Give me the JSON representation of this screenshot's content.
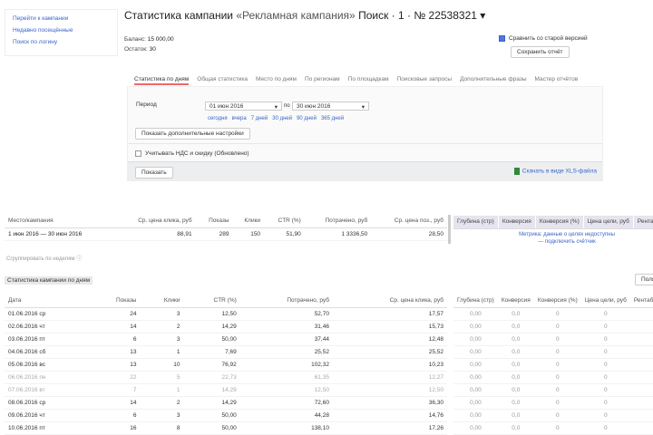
{
  "sidebar": {
    "links": [
      "Перейти к кампании",
      "Недавно посещённые",
      "Поиск по логину"
    ]
  },
  "header": {
    "title": "Статистика кампании",
    "campaign": "«Рекламная кампания»",
    "suffix": "Поиск · 1 · № 22538321 ▾",
    "balance_label": "Баланс:",
    "balance": "15 000,00",
    "rest_label": "Остаток:",
    "rest": "30",
    "compare_label": "Сравнить со старой версией",
    "save_button": "Сохранить отчёт"
  },
  "tabs": [
    "Статистика по дням",
    "Общая статистика",
    "Место по дням",
    "По регионам",
    "По площадкам",
    "Поисковые запросы",
    "Дополнительные фразы",
    "Мастер отчётов"
  ],
  "filter": {
    "period_label": "Период",
    "date_from": "01 июн 2016",
    "to_label": "по",
    "date_to": "30 июн 2016",
    "quick": [
      "сегодня",
      "вчера",
      "7 дней",
      "30 дней",
      "90 дней",
      "365 дней"
    ],
    "more_settings": "Показать дополнительные настройки",
    "checkbox_label": "Учитывать НДС и скидку (Обновлено)",
    "show_button": "Показать",
    "excel_link": "Скачать в виде XLS-файла"
  },
  "summary": {
    "headers": [
      "Место/кампания",
      "Ср. цена клика, руб",
      "Показы",
      "Клики",
      "CTR (%)",
      "Потрачено, руб",
      "Ср. цена поз., руб"
    ],
    "row": [
      "1 июн 2016 — 30 июн 2016",
      "88,91",
      "289",
      "150",
      "51,90",
      "1 3336,50",
      "28,50"
    ],
    "right_headers": [
      "Глубина (стр)",
      "Конверсия",
      "Конверсия (%)",
      "Цена цели, руб",
      "Рентабельность"
    ],
    "right_link": "Метрика: данные о целях недоступны — подключить счётчик",
    "group_note": "Сгруппировать по неделям  ⓘ"
  },
  "daily": {
    "section_title": "Статистика кампании по дням",
    "settings_button": "Поля",
    "headers": [
      "Дата",
      "Показы",
      "Клики",
      "CTR (%)",
      "Потрачено, руб",
      "Ср. цена клика, руб"
    ],
    "right_headers": [
      "Глубина (стр)",
      "Конверсия",
      "Конверсия (%)",
      "Цена цели, руб",
      "Рентабельность"
    ],
    "rows": [
      [
        "01.06.2016 ср",
        "24",
        "3",
        "12,50",
        "52,70",
        "17,57"
      ],
      [
        "02.06.2016 чт",
        "14",
        "2",
        "14,29",
        "31,46",
        "15,73"
      ],
      [
        "03.06.2016 пт",
        "6",
        "3",
        "50,00",
        "37,44",
        "12,48"
      ],
      [
        "04.06.2016 сб",
        "13",
        "1",
        "7,69",
        "25,52",
        "25,52"
      ],
      [
        "05.06.2016 вс",
        "13",
        "10",
        "76,92",
        "102,32",
        "10,23"
      ],
      [
        "06.06.2016 пн",
        "22",
        "5",
        "22,73",
        "61,35",
        "12,27"
      ],
      [
        "07.06.2016 вт",
        "7",
        "1",
        "14,29",
        "12,50",
        "12,50"
      ],
      [
        "08.06.2016 ср",
        "14",
        "2",
        "14,29",
        "72,60",
        "36,30"
      ],
      [
        "09.06.2016 чт",
        "6",
        "3",
        "50,00",
        "44,28",
        "14,76"
      ],
      [
        "10.06.2016 пт",
        "16",
        "8",
        "50,00",
        "138,10",
        "17,26"
      ]
    ],
    "right_rows": [
      [
        "0,00",
        "0,0",
        "0",
        "0"
      ],
      [
        "0,00",
        "0,0",
        "0",
        "0"
      ],
      [
        "0,00",
        "0,0",
        "0",
        "0"
      ],
      [
        "0,00",
        "0,0",
        "0",
        "0"
      ],
      [
        "0,00",
        "0,0",
        "0",
        "0"
      ],
      [
        "0,00",
        "0,0",
        "0",
        "0"
      ],
      [
        "0,00",
        "0,0",
        "0",
        "0"
      ],
      [
        "0,00",
        "0,0",
        "0",
        "0"
      ],
      [
        "0,00",
        "0,0",
        "0",
        "0"
      ],
      [
        "0,00",
        "0,0",
        "0",
        "0"
      ]
    ]
  }
}
